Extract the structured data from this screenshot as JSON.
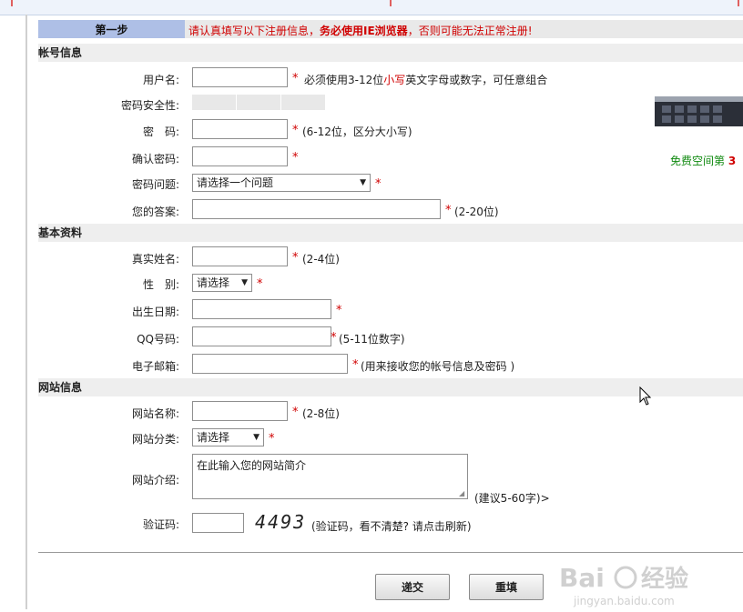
{
  "step": {
    "label": "第一步",
    "notice_pre": "请认真填写以下注册信息，",
    "notice_bold": "务必使用IE浏览器",
    "notice_post": "，否则可能无法正常注册!"
  },
  "sections": {
    "account": "帐号信息",
    "basic": "基本资料",
    "site": "网站信息"
  },
  "fields": {
    "username": {
      "label": "用户名:",
      "hint_pre": "必须使用3-12位",
      "hint_red": "小写",
      "hint_post": "英文字母或数字，可任意组合"
    },
    "pwd_strength": {
      "label": "密码安全性:"
    },
    "password": {
      "label": "密　码:",
      "hint": "(6-12位，区分大小写)"
    },
    "confirm": {
      "label": "确认密码:"
    },
    "question": {
      "label": "密码问题:",
      "selected": "请选择一个问题"
    },
    "answer": {
      "label": "您的答案:",
      "hint": "(2-20位)"
    },
    "realname": {
      "label": "真实姓名:",
      "hint": "(2-4位)"
    },
    "gender": {
      "label": "性　别:",
      "selected": "请选择"
    },
    "birthday": {
      "label": "出生日期:"
    },
    "qq": {
      "label": "QQ号码:",
      "hint": "(5-11位数字)"
    },
    "email": {
      "label": "电子邮箱:",
      "hint": "(用来接收您的帐号信息及密码 )"
    },
    "sitename": {
      "label": "网站名称:",
      "hint": "(2-8位)"
    },
    "category": {
      "label": "网站分类:",
      "selected": "请选择"
    },
    "intro": {
      "label": "网站介绍:",
      "value": "在此输入您的网站简介",
      "hint": "(建议5-60字)>"
    },
    "captcha": {
      "label": "验证码:",
      "code": "4493",
      "hint": "(验证码，看不清楚? 请点击刷新)"
    }
  },
  "star": "*",
  "promo": {
    "text": "免费空间第",
    "num": "3"
  },
  "buttons": {
    "submit": "递交",
    "reset": "重填"
  },
  "watermark": "Bai经验 jingyan.baidu.com"
}
